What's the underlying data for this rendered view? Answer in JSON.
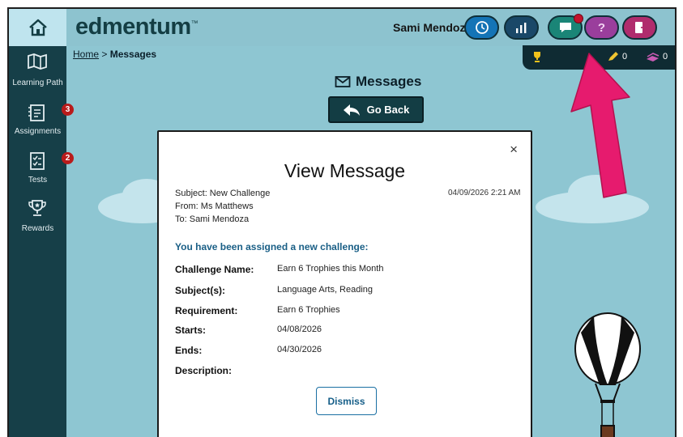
{
  "header": {
    "logo": "edmentum",
    "logo_tm": "™",
    "user_name": "Sami Mendoza",
    "help_label": "?"
  },
  "sidebar": {
    "items": [
      {
        "label": "Learning Path",
        "icon": "map-icon"
      },
      {
        "label": "Assignments",
        "icon": "assignments-icon",
        "badge": "3"
      },
      {
        "label": "Tests",
        "icon": "tests-icon",
        "badge": "2"
      },
      {
        "label": "Rewards",
        "icon": "trophy-icon"
      }
    ]
  },
  "breadcrumb": {
    "home": "Home",
    "separator": " > ",
    "current": "Messages"
  },
  "stats": {
    "pencil": "0",
    "books": "0"
  },
  "page": {
    "title": "Messages",
    "go_back": "Go Back"
  },
  "modal": {
    "close": "×",
    "title": "View Message",
    "subject": "Subject: New Challenge",
    "from": "From: Ms Matthews",
    "to": "To: Sami Mendoza",
    "date": "04/09/2026 2:21 AM",
    "assigned_text": "You have been assigned a new challenge:",
    "rows": [
      {
        "label": "Challenge Name:",
        "value": "Earn 6 Trophies this Month"
      },
      {
        "label": "Subject(s):",
        "value": "Language Arts, Reading"
      },
      {
        "label": "Requirement:",
        "value": "Earn 6 Trophies"
      },
      {
        "label": "Starts:",
        "value": "04/08/2026"
      },
      {
        "label": "Ends:",
        "value": "04/30/2026"
      },
      {
        "label": "Description:",
        "value": ""
      }
    ],
    "dismiss": "Dismiss"
  },
  "colors": {
    "sidebar": "#163f48",
    "background": "#8ec6d2",
    "annotation_arrow": "#e61b6e",
    "link": "#1a5f86"
  }
}
